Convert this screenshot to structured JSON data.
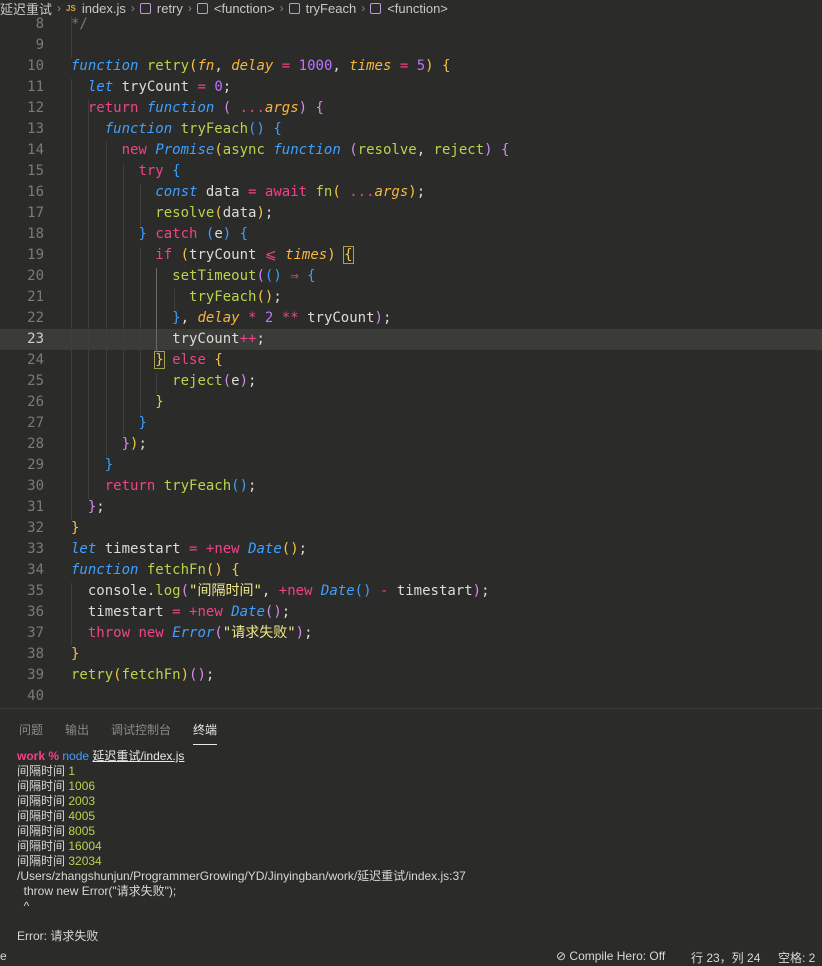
{
  "breadcrumb": {
    "folder": "延迟重试",
    "file": "index.js",
    "file_icon_label": "JS",
    "symbols": [
      "retry",
      "<function>",
      "tryFeach",
      "<function>"
    ]
  },
  "editor": {
    "active_line": 23,
    "lines": [
      {
        "n": "8"
      },
      {
        "n": "9"
      },
      {
        "n": "10"
      },
      {
        "n": "11"
      },
      {
        "n": "12"
      },
      {
        "n": "13"
      },
      {
        "n": "14"
      },
      {
        "n": "15"
      },
      {
        "n": "16"
      },
      {
        "n": "17"
      },
      {
        "n": "18"
      },
      {
        "n": "19"
      },
      {
        "n": "20"
      },
      {
        "n": "21"
      },
      {
        "n": "22"
      },
      {
        "n": "23"
      },
      {
        "n": "24"
      },
      {
        "n": "25"
      },
      {
        "n": "26"
      },
      {
        "n": "27"
      },
      {
        "n": "28"
      },
      {
        "n": "29"
      },
      {
        "n": "30"
      },
      {
        "n": "31"
      },
      {
        "n": "32"
      },
      {
        "n": "33"
      },
      {
        "n": "34"
      },
      {
        "n": "35"
      },
      {
        "n": "36"
      },
      {
        "n": "37"
      },
      {
        "n": "38"
      },
      {
        "n": "39"
      },
      {
        "n": "40"
      }
    ],
    "code": [
      [
        [
          "cm",
          "*/"
        ]
      ],
      [],
      [
        [
          "kw",
          "function"
        ],
        [
          "pl",
          " "
        ],
        [
          "fn",
          "retry"
        ],
        [
          "br1",
          "("
        ],
        [
          "pm",
          "fn"
        ],
        [
          "pl",
          ", "
        ],
        [
          "pm",
          "delay"
        ],
        [
          "pl",
          " "
        ],
        [
          "op",
          "="
        ],
        [
          "pl",
          " "
        ],
        [
          "nm",
          "1000"
        ],
        [
          "pl",
          ", "
        ],
        [
          "pm",
          "times"
        ],
        [
          "pl",
          " "
        ],
        [
          "op",
          "="
        ],
        [
          "pl",
          " "
        ],
        [
          "nm",
          "5"
        ],
        [
          "br1",
          ")"
        ],
        [
          "pl",
          " "
        ],
        [
          "br1",
          "{"
        ]
      ],
      [
        [
          "pl",
          "  "
        ],
        [
          "kw",
          "let"
        ],
        [
          "pl",
          " tryCount "
        ],
        [
          "op",
          "="
        ],
        [
          "pl",
          " "
        ],
        [
          "nm",
          "0"
        ],
        [
          "pl",
          ";"
        ]
      ],
      [
        [
          "pl",
          "  "
        ],
        [
          "kr",
          "return"
        ],
        [
          "pl",
          " "
        ],
        [
          "kw",
          "function"
        ],
        [
          "pl",
          " "
        ],
        [
          "br2",
          "("
        ],
        [
          "pl",
          " "
        ],
        [
          "op",
          "..."
        ],
        [
          "pm",
          "args"
        ],
        [
          "br2",
          ")"
        ],
        [
          "pl",
          " "
        ],
        [
          "br2",
          "{"
        ]
      ],
      [
        [
          "pl",
          "    "
        ],
        [
          "kw",
          "function"
        ],
        [
          "pl",
          " "
        ],
        [
          "fn",
          "tryFeach"
        ],
        [
          "br3",
          "()"
        ],
        [
          "pl",
          " "
        ],
        [
          "br3",
          "{"
        ]
      ],
      [
        [
          "pl",
          "      "
        ],
        [
          "kr",
          "new"
        ],
        [
          "pl",
          " "
        ],
        [
          "cls",
          "Promise"
        ],
        [
          "br1",
          "("
        ],
        [
          "fn",
          "async"
        ],
        [
          "pl",
          " "
        ],
        [
          "kw",
          "function"
        ],
        [
          "pl",
          " "
        ],
        [
          "br2",
          "("
        ],
        [
          "fn",
          "resolve"
        ],
        [
          "pl",
          ", "
        ],
        [
          "fn",
          "reject"
        ],
        [
          "br2",
          ")"
        ],
        [
          "pl",
          " "
        ],
        [
          "br2",
          "{"
        ]
      ],
      [
        [
          "pl",
          "        "
        ],
        [
          "kr",
          "try"
        ],
        [
          "pl",
          " "
        ],
        [
          "br3",
          "{"
        ]
      ],
      [
        [
          "pl",
          "          "
        ],
        [
          "kw",
          "const"
        ],
        [
          "pl",
          " data "
        ],
        [
          "op",
          "="
        ],
        [
          "pl",
          " "
        ],
        [
          "kr",
          "await"
        ],
        [
          "pl",
          " "
        ],
        [
          "fn",
          "fn"
        ],
        [
          "br1",
          "("
        ],
        [
          "pl",
          " "
        ],
        [
          "op",
          "..."
        ],
        [
          "pm",
          "args"
        ],
        [
          "br1",
          ")"
        ],
        [
          "pl",
          ";"
        ]
      ],
      [
        [
          "pl",
          "          "
        ],
        [
          "fn",
          "resolve"
        ],
        [
          "br1",
          "("
        ],
        [
          "pl",
          "data"
        ],
        [
          "br1",
          ")"
        ],
        [
          "pl",
          ";"
        ]
      ],
      [
        [
          "pl",
          "        "
        ],
        [
          "br3",
          "}"
        ],
        [
          "pl",
          " "
        ],
        [
          "kr",
          "catch"
        ],
        [
          "pl",
          " "
        ],
        [
          "br3",
          "("
        ],
        [
          "pl",
          "e"
        ],
        [
          "br3",
          ")"
        ],
        [
          "pl",
          " "
        ],
        [
          "br3",
          "{"
        ]
      ],
      [
        [
          "pl",
          "          "
        ],
        [
          "kr",
          "if"
        ],
        [
          "pl",
          " "
        ],
        [
          "br1",
          "("
        ],
        [
          "pl",
          "tryCount "
        ],
        [
          "op",
          "⩽"
        ],
        [
          "pl",
          " "
        ],
        [
          "pm",
          "times"
        ],
        [
          "br1",
          ")"
        ],
        [
          "pl",
          " "
        ],
        [
          "br1 box",
          "{"
        ]
      ],
      [
        [
          "pl",
          "            "
        ],
        [
          "fn",
          "setTimeout"
        ],
        [
          "br2",
          "("
        ],
        [
          "br3",
          "()"
        ],
        [
          "pl",
          " "
        ],
        [
          "op",
          "⇒"
        ],
        [
          "pl",
          " "
        ],
        [
          "br3",
          "{"
        ]
      ],
      [
        [
          "pl",
          "              "
        ],
        [
          "fn",
          "tryFeach"
        ],
        [
          "br1",
          "()"
        ],
        [
          "pl",
          ";"
        ]
      ],
      [
        [
          "pl",
          "            "
        ],
        [
          "br3",
          "}"
        ],
        [
          "pl",
          ", "
        ],
        [
          "pm",
          "delay"
        ],
        [
          "pl",
          " "
        ],
        [
          "op",
          "*"
        ],
        [
          "pl",
          " "
        ],
        [
          "nm",
          "2"
        ],
        [
          "pl",
          " "
        ],
        [
          "op",
          "**"
        ],
        [
          "pl",
          " tryCount"
        ],
        [
          "br2",
          ")"
        ],
        [
          "pl",
          ";"
        ]
      ],
      [
        [
          "pl",
          "            tryCount"
        ],
        [
          "op",
          "++"
        ],
        [
          "pl",
          ";"
        ]
      ],
      [
        [
          "pl",
          "          "
        ],
        [
          "br1 box",
          "}"
        ],
        [
          "pl",
          " "
        ],
        [
          "kr",
          "else"
        ],
        [
          "pl",
          " "
        ],
        [
          "br1",
          "{"
        ]
      ],
      [
        [
          "pl",
          "            "
        ],
        [
          "fn",
          "reject"
        ],
        [
          "br2",
          "("
        ],
        [
          "pl",
          "e"
        ],
        [
          "br2",
          ")"
        ],
        [
          "pl",
          ";"
        ]
      ],
      [
        [
          "pl",
          "          "
        ],
        [
          "br1",
          "}"
        ]
      ],
      [
        [
          "pl",
          "        "
        ],
        [
          "br3",
          "}"
        ]
      ],
      [
        [
          "pl",
          "      "
        ],
        [
          "br2",
          "}"
        ],
        [
          "br1",
          ")"
        ],
        [
          "pl",
          ";"
        ]
      ],
      [
        [
          "pl",
          "    "
        ],
        [
          "br3",
          "}"
        ]
      ],
      [
        [
          "pl",
          "    "
        ],
        [
          "kr",
          "return"
        ],
        [
          "pl",
          " "
        ],
        [
          "fn",
          "tryFeach"
        ],
        [
          "br3",
          "()"
        ],
        [
          "pl",
          ";"
        ]
      ],
      [
        [
          "pl",
          "  "
        ],
        [
          "br2",
          "}"
        ],
        [
          "pl",
          ";"
        ]
      ],
      [
        [
          "br1",
          "}"
        ]
      ],
      [
        [
          "kw",
          "let"
        ],
        [
          "pl",
          " timestart "
        ],
        [
          "op",
          "="
        ],
        [
          "pl",
          " "
        ],
        [
          "op",
          "+"
        ],
        [
          "kr",
          "new"
        ],
        [
          "pl",
          " "
        ],
        [
          "cls",
          "Date"
        ],
        [
          "br1",
          "()"
        ],
        [
          "pl",
          ";"
        ]
      ],
      [
        [
          "kw",
          "function"
        ],
        [
          "pl",
          " "
        ],
        [
          "fn",
          "fetchFn"
        ],
        [
          "br1",
          "()"
        ],
        [
          "pl",
          " "
        ],
        [
          "br1",
          "{"
        ]
      ],
      [
        [
          "pl",
          "  console."
        ],
        [
          "fn",
          "log"
        ],
        [
          "br2",
          "("
        ],
        [
          "st",
          "\"间隔时间\""
        ],
        [
          "pl",
          ", "
        ],
        [
          "op",
          "+"
        ],
        [
          "kr",
          "new"
        ],
        [
          "pl",
          " "
        ],
        [
          "cls",
          "Date"
        ],
        [
          "br3",
          "()"
        ],
        [
          "pl",
          " "
        ],
        [
          "op",
          "-"
        ],
        [
          "pl",
          " timestart"
        ],
        [
          "br2",
          ")"
        ],
        [
          "pl",
          ";"
        ]
      ],
      [
        [
          "pl",
          "  timestart "
        ],
        [
          "op",
          "="
        ],
        [
          "pl",
          " "
        ],
        [
          "op",
          "+"
        ],
        [
          "kr",
          "new"
        ],
        [
          "pl",
          " "
        ],
        [
          "cls",
          "Date"
        ],
        [
          "br2",
          "()"
        ],
        [
          "pl",
          ";"
        ]
      ],
      [
        [
          "pl",
          "  "
        ],
        [
          "kr",
          "throw"
        ],
        [
          "pl",
          " "
        ],
        [
          "kr",
          "new"
        ],
        [
          "pl",
          " "
        ],
        [
          "cls",
          "Error"
        ],
        [
          "br2",
          "("
        ],
        [
          "st",
          "\"请求失败\""
        ],
        [
          "br2",
          ")"
        ],
        [
          "pl",
          ";"
        ]
      ],
      [
        [
          "br1",
          "}"
        ]
      ],
      [
        [
          "fn",
          "retry"
        ],
        [
          "br1",
          "("
        ],
        [
          "fn",
          "fetchFn"
        ],
        [
          "br1",
          ")"
        ],
        [
          "br2",
          "()"
        ],
        [
          "pl",
          ";"
        ]
      ],
      []
    ]
  },
  "panel": {
    "tabs": [
      {
        "label": "问题",
        "active": false
      },
      {
        "label": "输出",
        "active": false
      },
      {
        "label": "调试控制台",
        "active": false
      },
      {
        "label": "终端",
        "active": true
      }
    ],
    "terminal": {
      "prompt": "work %",
      "command": "node",
      "argument": "延迟重试/index.js",
      "log_label": "间隔时间",
      "log_values": [
        "1",
        "1006",
        "2003",
        "4005",
        "8005",
        "16004",
        "32034"
      ],
      "error_path": "/Users/zhangshunjun/ProgrammerGrowing/YD/Jinyingban/work/延迟重试/index.js:37",
      "error_code": "  throw new Error(\"请求失败\");",
      "error_caret": "  ^",
      "error_message": "Error: 请求失败"
    }
  },
  "status": {
    "left_glyph": "e",
    "compile_hero": "Compile Hero: Off",
    "position": "行 23，列 24",
    "indent": "空格: 2"
  }
}
